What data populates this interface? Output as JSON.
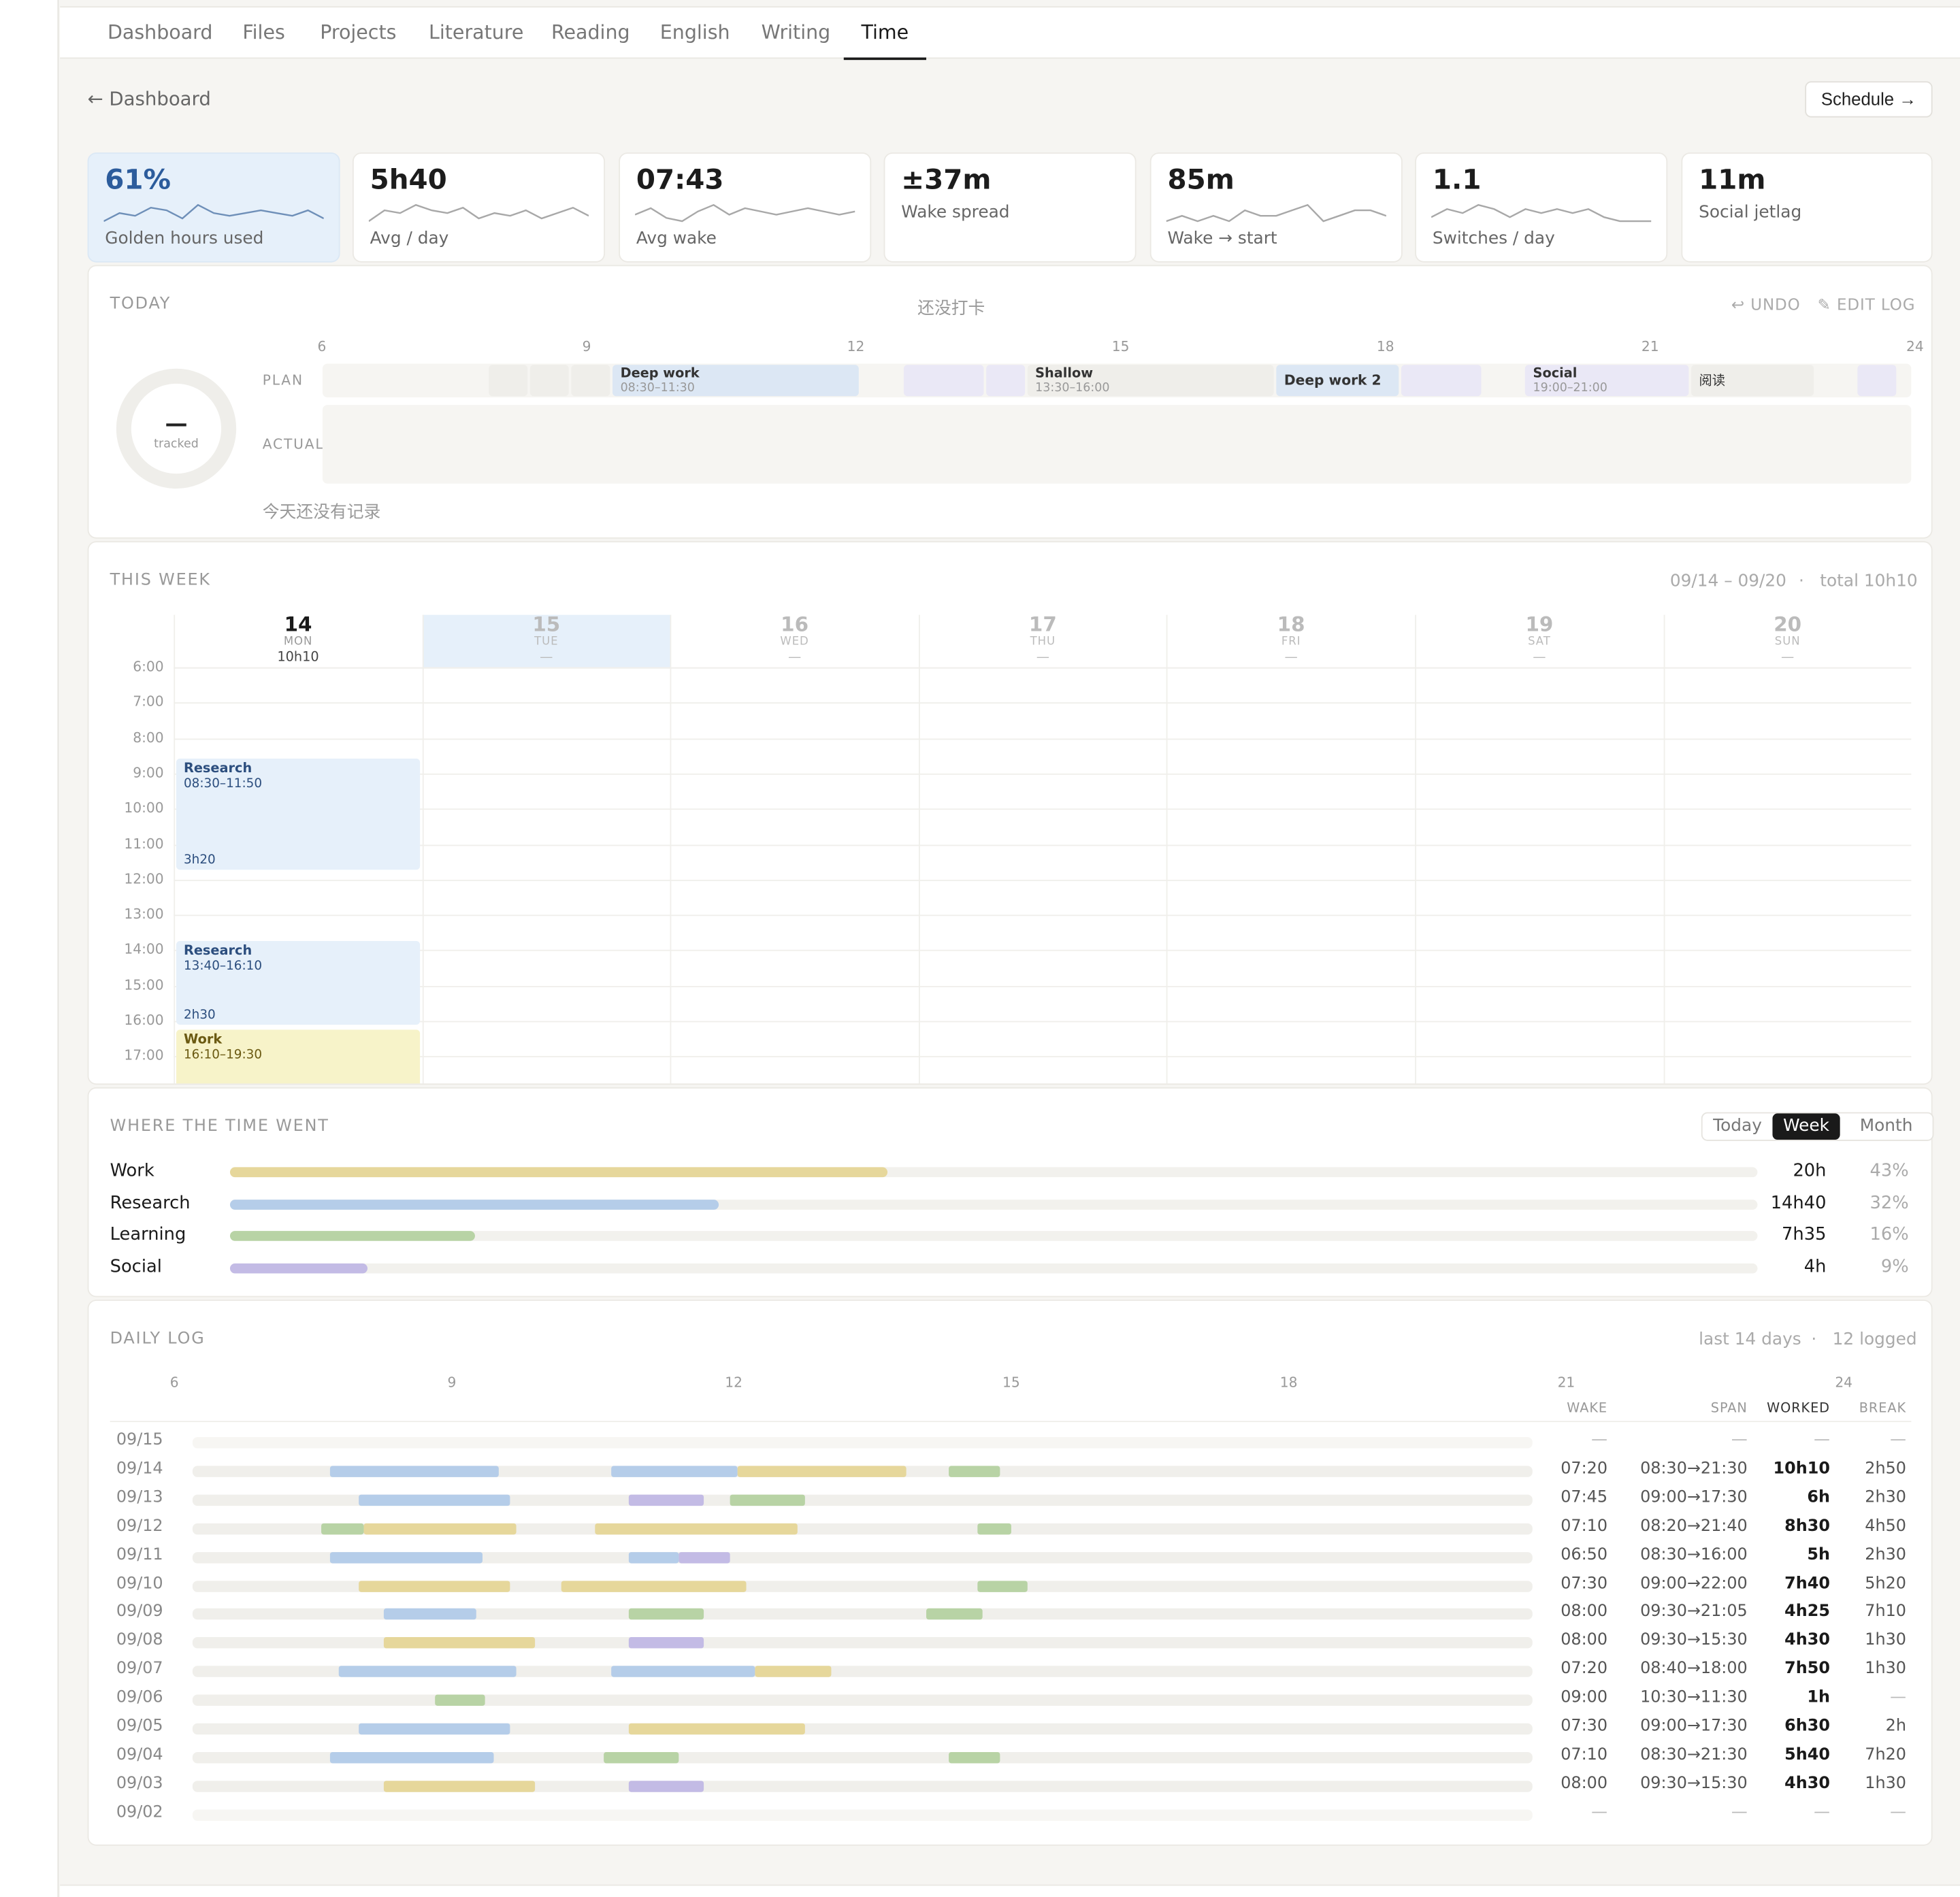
{
  "colors": {
    "research": "#b5cde9",
    "work": "#e6d79b",
    "learning": "#b8d3a5",
    "social": "#c3bbe5",
    "plan_research": "#dce7f4",
    "plan_social": "#eae8f6",
    "plan_gray": "#efeeea",
    "accent": "#2c5c9c"
  },
  "nav": {
    "items": [
      "Dashboard",
      "Files",
      "Projects",
      "Literature",
      "Reading",
      "English",
      "Writing",
      "Time"
    ],
    "active": "Time"
  },
  "header": {
    "back_label": "← Dashboard",
    "schedule_label": "Schedule →"
  },
  "stats": [
    {
      "value": "61%",
      "label": "Golden hours used",
      "sparkline": [
        2,
        5,
        4,
        7,
        6,
        3,
        8,
        5,
        4,
        5,
        6,
        5,
        4,
        6,
        3
      ],
      "highlight": true
    },
    {
      "value": "5h40",
      "label": "Avg / day",
      "sparkline": [
        2,
        6,
        5,
        8,
        6,
        5,
        7,
        3,
        5,
        4,
        6,
        3,
        5,
        7,
        4
      ]
    },
    {
      "value": "07:43",
      "label": "Avg wake",
      "sparkline": [
        4,
        6,
        3,
        2,
        5,
        7,
        4,
        6,
        5,
        4,
        5,
        6,
        5,
        4,
        5
      ]
    },
    {
      "value": "±37m",
      "label": "Wake spread",
      "sparkline": null
    },
    {
      "value": "85m",
      "label": "Wake → start",
      "sparkline": [
        5,
        6,
        5,
        6,
        5,
        7,
        6,
        6,
        7,
        8,
        5,
        6,
        7,
        7,
        6
      ]
    },
    {
      "value": "1.1",
      "label": "Switches / day",
      "sparkline": [
        4,
        6,
        5,
        7,
        6,
        4,
        6,
        5,
        6,
        5,
        6,
        4,
        3,
        3,
        3
      ]
    },
    {
      "value": "11m",
      "label": "Social jetlag",
      "sparkline": null
    }
  ],
  "today": {
    "title": "TODAY",
    "status": "还没打卡",
    "undo_label": "↩ UNDO",
    "edit_label": "✎ EDIT LOG",
    "ticks": [
      "6",
      "9",
      "12",
      "15",
      "18",
      "21",
      "24"
    ],
    "donut_value": "—",
    "donut_label": "tracked",
    "plan_label": "PLAN",
    "actual_label": "ACTUAL",
    "empty_note": "今天还没有记录",
    "plan": [
      {
        "start": 8.0,
        "end": 8.5,
        "kind": "gray"
      },
      {
        "start": 8.5,
        "end": 9.0,
        "kind": "gray"
      },
      {
        "start": 9.0,
        "end": 9.5,
        "kind": "gray"
      },
      {
        "start": 9.5,
        "end": 12.5,
        "kind": "research",
        "title": "Deep work",
        "sub": "08:30–11:30"
      },
      {
        "start": 13.0,
        "end": 14.0,
        "kind": "social"
      },
      {
        "start": 14.0,
        "end": 14.5,
        "kind": "social"
      },
      {
        "start": 14.5,
        "end": 17.5,
        "kind": "gray",
        "title": "Shallow",
        "sub": "13:30–16:00"
      },
      {
        "start": 17.5,
        "end": 19.0,
        "kind": "research",
        "center": "Deep work 2"
      },
      {
        "start": 19.0,
        "end": 20.0,
        "kind": "social"
      },
      {
        "start": 20.5,
        "end": 22.5,
        "kind": "social",
        "title": "Social",
        "sub": "19:00–21:00"
      },
      {
        "start": 22.5,
        "end": 24.0,
        "kind": "gray",
        "note": "阅读"
      },
      {
        "start": 24.5,
        "end": 25.0,
        "kind": "social"
      }
    ]
  },
  "week": {
    "title": "THIS WEEK",
    "range": "09/14 – 09/20",
    "separator": "·",
    "total": "total 10h10",
    "days": [
      {
        "num": "14",
        "dow": "MON",
        "total": "10h10"
      },
      {
        "num": "15",
        "dow": "TUE",
        "total": "—"
      },
      {
        "num": "16",
        "dow": "WED",
        "total": "—"
      },
      {
        "num": "17",
        "dow": "THU",
        "total": "—"
      },
      {
        "num": "18",
        "dow": "FRI",
        "total": "—"
      },
      {
        "num": "19",
        "dow": "SAT",
        "total": "—"
      },
      {
        "num": "20",
        "dow": "SUN",
        "total": "—"
      }
    ],
    "today_index": 1,
    "hours": [
      "6:00",
      "7:00",
      "8:00",
      "9:00",
      "10:00",
      "11:00",
      "12:00",
      "13:00",
      "14:00",
      "15:00",
      "16:00",
      "17:00"
    ],
    "events": [
      {
        "day": 0,
        "title": "Research",
        "range": "08:30–11:50",
        "duration": "3h20",
        "start": 8.5,
        "end": 11.8,
        "kind": "research"
      },
      {
        "day": 0,
        "title": "Research",
        "range": "13:40–16:10",
        "duration": "2h30",
        "start": 13.67,
        "end": 16.17,
        "kind": "research"
      },
      {
        "day": 0,
        "title": "Work",
        "range": "16:10–19:30",
        "duration": "",
        "start": 16.17,
        "end": 19.5,
        "kind": "work"
      }
    ]
  },
  "where": {
    "title": "WHERE THE TIME WENT",
    "tabs": [
      "Today",
      "Week",
      "Month"
    ],
    "active_tab": "Week",
    "rows": [
      {
        "name": "Work",
        "hours": "20h",
        "pct": "43%",
        "fraction": 0.43,
        "kind": "work"
      },
      {
        "name": "Research",
        "hours": "14h40",
        "pct": "32%",
        "fraction": 0.32,
        "kind": "research"
      },
      {
        "name": "Learning",
        "hours": "7h35",
        "pct": "16%",
        "fraction": 0.16,
        "kind": "learning"
      },
      {
        "name": "Social",
        "hours": "4h",
        "pct": "9%",
        "fraction": 0.09,
        "kind": "social"
      }
    ]
  },
  "log": {
    "title": "DAILY LOG",
    "range": "last 14 days",
    "separator": "·",
    "logged": "12 logged",
    "ticks": [
      "6",
      "9",
      "12",
      "15",
      "18",
      "21",
      "24"
    ],
    "columns": [
      "WAKE",
      "SPAN",
      "WORKED",
      "BREAK"
    ],
    "rows": [
      {
        "date": "09/15",
        "wake": "—",
        "span": "—",
        "worked": "—",
        "break": "—",
        "segs": []
      },
      {
        "date": "09/14",
        "wake": "07:20",
        "span": "08:30→21:30",
        "worked": "10h10",
        "break": "2h50",
        "segs": [
          [
            8.5,
            11.5,
            "research"
          ],
          [
            13.5,
            15.75,
            "research"
          ],
          [
            15.75,
            18.75,
            "work"
          ],
          [
            19.5,
            20.4,
            "learning"
          ]
        ]
      },
      {
        "date": "09/13",
        "wake": "07:45",
        "span": "09:00→17:30",
        "worked": "6h",
        "break": "2h30",
        "segs": [
          [
            9.0,
            11.7,
            "research"
          ],
          [
            13.8,
            15.15,
            "social"
          ],
          [
            15.6,
            16.95,
            "learning"
          ]
        ]
      },
      {
        "date": "09/12",
        "wake": "07:10",
        "span": "08:20→21:40",
        "worked": "8h30",
        "break": "4h50",
        "segs": [
          [
            8.33,
            9.1,
            "learning"
          ],
          [
            9.1,
            11.8,
            "work"
          ],
          [
            13.2,
            16.8,
            "work"
          ],
          [
            20.0,
            20.6,
            "learning"
          ]
        ]
      },
      {
        "date": "09/11",
        "wake": "06:50",
        "span": "08:30→16:00",
        "worked": "5h",
        "break": "2h30",
        "segs": [
          [
            8.5,
            11.2,
            "research"
          ],
          [
            13.8,
            14.7,
            "research"
          ],
          [
            14.7,
            15.6,
            "social"
          ]
        ]
      },
      {
        "date": "09/10",
        "wake": "07:30",
        "span": "09:00→22:00",
        "worked": "7h40",
        "break": "5h20",
        "segs": [
          [
            9.0,
            11.7,
            "work"
          ],
          [
            12.6,
            15.9,
            "work"
          ],
          [
            20.0,
            20.9,
            "learning"
          ]
        ]
      },
      {
        "date": "09/09",
        "wake": "08:00",
        "span": "09:30→21:05",
        "worked": "4h25",
        "break": "7h10",
        "segs": [
          [
            9.45,
            11.1,
            "research"
          ],
          [
            13.8,
            15.15,
            "learning"
          ],
          [
            19.1,
            20.1,
            "learning"
          ]
        ]
      },
      {
        "date": "09/08",
        "wake": "08:00",
        "span": "09:30→15:30",
        "worked": "4h30",
        "break": "1h30",
        "segs": [
          [
            9.45,
            12.15,
            "work"
          ],
          [
            13.8,
            15.15,
            "social"
          ]
        ]
      },
      {
        "date": "09/07",
        "wake": "07:20",
        "span": "08:40→18:00",
        "worked": "7h50",
        "break": "1h30",
        "segs": [
          [
            8.65,
            11.8,
            "research"
          ],
          [
            13.5,
            16.05,
            "research"
          ],
          [
            16.05,
            17.4,
            "work"
          ]
        ]
      },
      {
        "date": "09/06",
        "wake": "09:00",
        "span": "10:30→11:30",
        "worked": "1h",
        "break": "—",
        "segs": [
          [
            10.35,
            11.25,
            "learning"
          ]
        ]
      },
      {
        "date": "09/05",
        "wake": "07:30",
        "span": "09:00→17:30",
        "worked": "6h30",
        "break": "2h",
        "segs": [
          [
            9.0,
            11.7,
            "research"
          ],
          [
            13.8,
            16.95,
            "work"
          ]
        ]
      },
      {
        "date": "09/04",
        "wake": "07:10",
        "span": "08:30→21:30",
        "worked": "5h40",
        "break": "7h20",
        "segs": [
          [
            8.5,
            11.4,
            "research"
          ],
          [
            13.35,
            14.7,
            "learning"
          ],
          [
            19.5,
            20.4,
            "learning"
          ]
        ]
      },
      {
        "date": "09/03",
        "wake": "08:00",
        "span": "09:30→15:30",
        "worked": "4h30",
        "break": "1h30",
        "segs": [
          [
            9.45,
            12.15,
            "work"
          ],
          [
            13.8,
            15.15,
            "social"
          ]
        ]
      },
      {
        "date": "09/02",
        "wake": "—",
        "span": "—",
        "worked": "—",
        "break": "—",
        "segs": []
      }
    ]
  }
}
